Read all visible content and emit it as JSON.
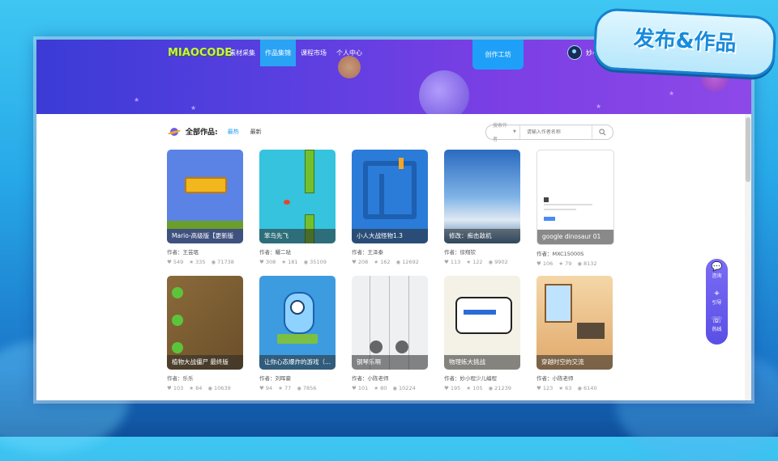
{
  "badge_text": "发布&作品",
  "logo_text": "MIAOCODE",
  "nav": {
    "items": [
      {
        "label": "素材采集",
        "active": false
      },
      {
        "label": "作品集锦",
        "active": true
      },
      {
        "label": "课程市场",
        "active": false
      },
      {
        "label": "个人中心",
        "active": false
      }
    ],
    "create_button": "创作工坊",
    "username": "妙小程"
  },
  "section": {
    "title": "全部作品:",
    "tabs": [
      {
        "label": "最热",
        "active": true
      },
      {
        "label": "最新",
        "active": false
      }
    ],
    "search_select": "搜索作者",
    "search_placeholder": "请输入作者名称"
  },
  "cards": [
    {
      "title": "Mario-高级版【更新版",
      "author": "作者：王芸珉",
      "likes": "549",
      "stars": "335",
      "views": "71738",
      "thumb": "mario"
    },
    {
      "title": "笨鸟先飞",
      "author": "作者：耀二哒",
      "likes": "308",
      "stars": "181",
      "views": "35109",
      "thumb": "bird"
    },
    {
      "title": "小人大战怪物1.3",
      "author": "作者：王泽泰",
      "likes": "208",
      "stars": "162",
      "views": "12692",
      "thumb": "maze"
    },
    {
      "title": "修改：痴击敌机",
      "author": "作者：徐翔钦",
      "likes": "113",
      "stars": "122",
      "views": "9902",
      "thumb": "sky"
    },
    {
      "title": "google dinosaur 01",
      "author": "作者：MXC15000S",
      "likes": "106",
      "stars": "79",
      "views": "8132",
      "thumb": "dino"
    },
    {
      "title": "植物大战僵尸 最终版",
      "author": "作者：乐乐",
      "likes": "103",
      "stars": "84",
      "views": "10639",
      "thumb": "plants"
    },
    {
      "title": "让你心态爆炸的游戏（...",
      "author": "作者：刘晖豪",
      "likes": "94",
      "stars": "77",
      "views": "7856",
      "thumb": "monster"
    },
    {
      "title": "钢琴乐啊",
      "author": "作者：小陈老师",
      "likes": "101",
      "stars": "80",
      "views": "10224",
      "thumb": "piano"
    },
    {
      "title": "物理练大挑战",
      "author": "作者：妙小程少儿编程",
      "likes": "195",
      "stars": "105",
      "views": "21239",
      "thumb": "comic"
    },
    {
      "title": "穿越时空的交流",
      "author": "作者：小陈老师",
      "likes": "123",
      "stars": "63",
      "views": "6140",
      "thumb": "room"
    }
  ],
  "side_panel": [
    {
      "icon": "chat-icon",
      "label": "咨询"
    },
    {
      "icon": "guide-icon",
      "label": "引导"
    },
    {
      "icon": "phone-icon",
      "label": "热线"
    }
  ],
  "colors": {
    "accent": "#1e9df2",
    "banner": "#5a3fe0",
    "side": "#6a5cf0"
  }
}
